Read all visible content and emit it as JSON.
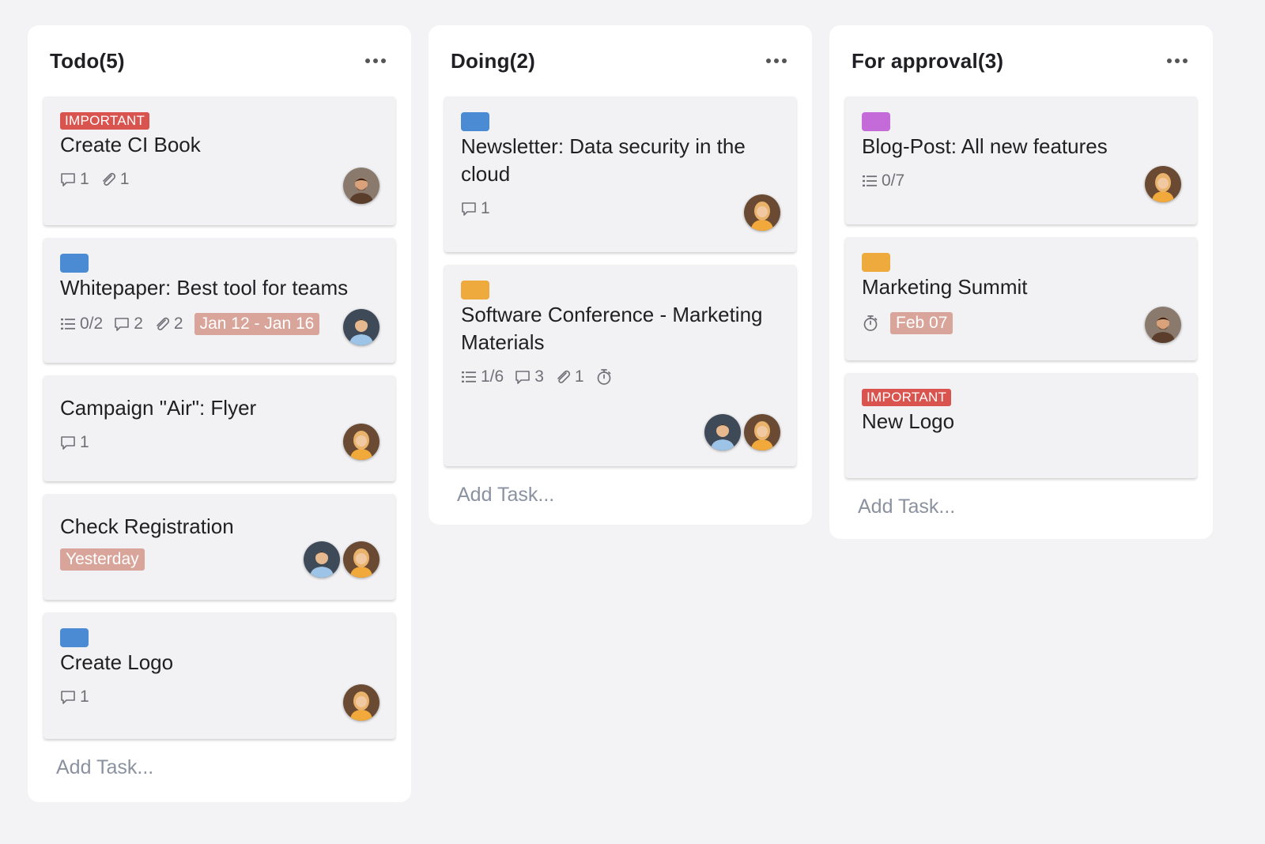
{
  "columns": [
    {
      "title": "Todo(5)",
      "add_label": "Add Task...",
      "cards": [
        {
          "badge": "IMPORTANT",
          "title": "Create CI Book",
          "comments": "1",
          "attachments": "1"
        },
        {
          "title": "Whitepaper: Best tool for teams",
          "checklist": "0/2",
          "comments": "2",
          "attachments": "2",
          "date": "Jan 12 - Jan 16"
        },
        {
          "title": "Campaign \"Air\": Flyer",
          "comments": "1"
        },
        {
          "title": "Check Registration",
          "date": "Yesterday"
        },
        {
          "title": "Create Logo",
          "comments": "1"
        }
      ]
    },
    {
      "title": "Doing(2)",
      "add_label": "Add Task...",
      "cards": [
        {
          "title": "Newsletter: Data security in the cloud",
          "comments": "1"
        },
        {
          "title": "Software Conference - Marketing Materials",
          "checklist": "1/6",
          "comments": "3",
          "attachments": "1"
        }
      ]
    },
    {
      "title": "For approval(3)",
      "add_label": "Add Task...",
      "cards": [
        {
          "title": "Blog-Post: All new features",
          "checklist": "0/7"
        },
        {
          "title": "Marketing Summit",
          "date": "Feb 07"
        },
        {
          "badge": "IMPORTANT",
          "title": "New Logo"
        }
      ]
    }
  ],
  "colors": {
    "blue_tag": "#4a8bd4",
    "orange_tag": "#eeaa3c",
    "purple_tag": "#c46bd9",
    "important": "#d9534f",
    "date_pill": "#d9a59b"
  }
}
